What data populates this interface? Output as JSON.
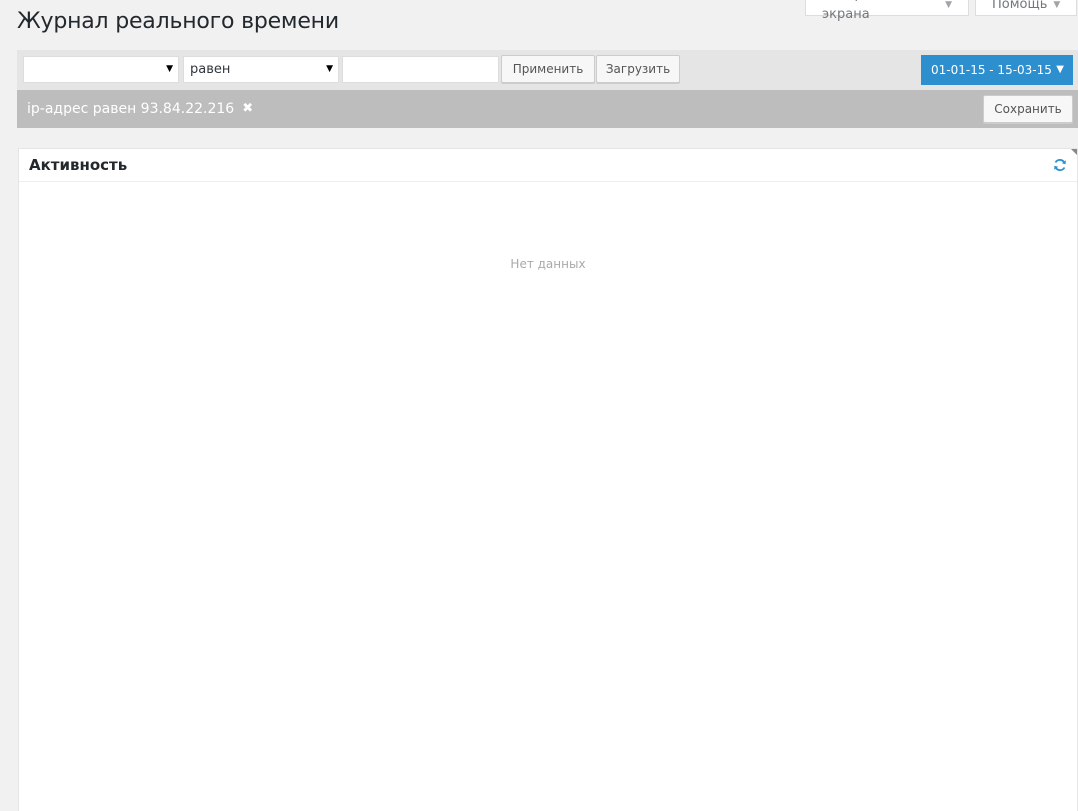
{
  "page": {
    "title": "Журнал реального времени"
  },
  "screen_tabs": {
    "screen_options": "Настройки экрана",
    "help": "Помощь"
  },
  "filter_bar": {
    "field_select_value": "",
    "operator_select_value": "равен",
    "value_input": "",
    "apply_label": "Применить",
    "load_label": "Загрузить",
    "date_range": "01-01-15 - 15-03-15"
  },
  "active_filters": {
    "filter_text": "ip-адрес равен 93.84.22.216",
    "save_label": "Сохранить"
  },
  "activity_panel": {
    "title": "Активность",
    "empty_message": "Нет данных"
  },
  "colors": {
    "accent": "#2e8fce",
    "background": "#f1f1f1",
    "filter_bar": "#e5e5e5",
    "active_filter_bar": "#bdbdbd"
  },
  "icons": {
    "refresh": "refresh-icon",
    "remove_filter": "close-icon",
    "dropdown": "chevron-down-icon"
  }
}
